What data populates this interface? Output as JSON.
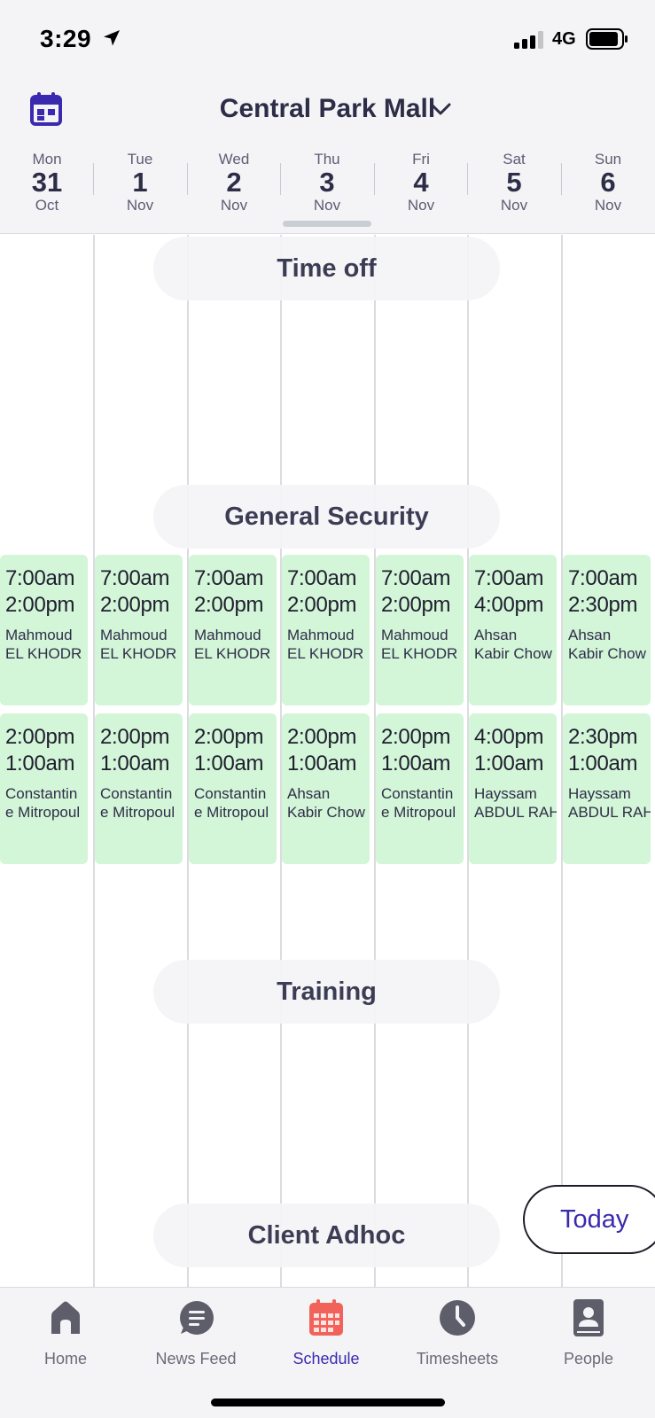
{
  "status_bar": {
    "time": "3:29",
    "network": "4G",
    "icons": [
      "location-arrow-icon",
      "signal-icon",
      "battery-icon"
    ]
  },
  "header": {
    "location": "Central Park Mall",
    "calendar_icon": "calendar-icon",
    "chevron_icon": "chevron-down-icon"
  },
  "days": [
    {
      "name": "Mon",
      "num": "31",
      "month": "Oct"
    },
    {
      "name": "Tue",
      "num": "1",
      "month": "Nov"
    },
    {
      "name": "Wed",
      "num": "2",
      "month": "Nov"
    },
    {
      "name": "Thu",
      "num": "3",
      "month": "Nov",
      "selected": true
    },
    {
      "name": "Fri",
      "num": "4",
      "month": "Nov"
    },
    {
      "name": "Sat",
      "num": "5",
      "month": "Nov"
    },
    {
      "name": "Sun",
      "num": "6",
      "month": "Nov"
    }
  ],
  "sections": {
    "time_off": "Time off",
    "general_security": "General Security",
    "training": "Training",
    "client_adhoc": "Client Adhoc"
  },
  "shifts_row1": [
    {
      "start": "7:00am",
      "end": "2:00pm",
      "name1": "Mahmoud",
      "name2": "EL KHODR"
    },
    {
      "start": "7:00am",
      "end": "2:00pm",
      "name1": "Mahmoud",
      "name2": "EL KHODR"
    },
    {
      "start": "7:00am",
      "end": "2:00pm",
      "name1": "Mahmoud",
      "name2": "EL KHODR"
    },
    {
      "start": "7:00am",
      "end": "2:00pm",
      "name1": "Mahmoud",
      "name2": "EL KHODR"
    },
    {
      "start": "7:00am",
      "end": "2:00pm",
      "name1": "Mahmoud",
      "name2": "EL KHODR"
    },
    {
      "start": "7:00am",
      "end": "4:00pm",
      "name1": "Ahsan",
      "name2": "Kabir Chow"
    },
    {
      "start": "7:00am",
      "end": "2:30pm",
      "name1": "Ahsan",
      "name2": "Kabir Chow"
    }
  ],
  "shifts_row2": [
    {
      "start": "2:00pm",
      "end": "1:00am",
      "name1": "Constantin",
      "name2": "e Mitropoul"
    },
    {
      "start": "2:00pm",
      "end": "1:00am",
      "name1": "Constantin",
      "name2": "e Mitropoul"
    },
    {
      "start": "2:00pm",
      "end": "1:00am",
      "name1": "Constantin",
      "name2": "e Mitropoul"
    },
    {
      "start": "2:00pm",
      "end": "1:00am",
      "name1": "Ahsan",
      "name2": "Kabir Chow"
    },
    {
      "start": "2:00pm",
      "end": "1:00am",
      "name1": "Constantin",
      "name2": "e Mitropoul"
    },
    {
      "start": "4:00pm",
      "end": "1:00am",
      "name1": "Hayssam",
      "name2": "ABDUL RAH"
    },
    {
      "start": "2:30pm",
      "end": "1:00am",
      "name1": "Hayssam",
      "name2": "ABDUL RAH"
    }
  ],
  "today_button": "Today",
  "tabs": [
    {
      "label": "Home",
      "icon": "home-icon"
    },
    {
      "label": "News Feed",
      "icon": "chat-bubble-icon"
    },
    {
      "label": "Schedule",
      "icon": "calendar-grid-icon",
      "active": true
    },
    {
      "label": "Timesheets",
      "icon": "clock-icon"
    },
    {
      "label": "People",
      "icon": "contact-book-icon"
    }
  ],
  "colors": {
    "accent": "#3a2ab0",
    "shift_bg": "#d3f5d8",
    "schedule_active": "#f0625a",
    "tab_icon": "#5e5d6a"
  }
}
